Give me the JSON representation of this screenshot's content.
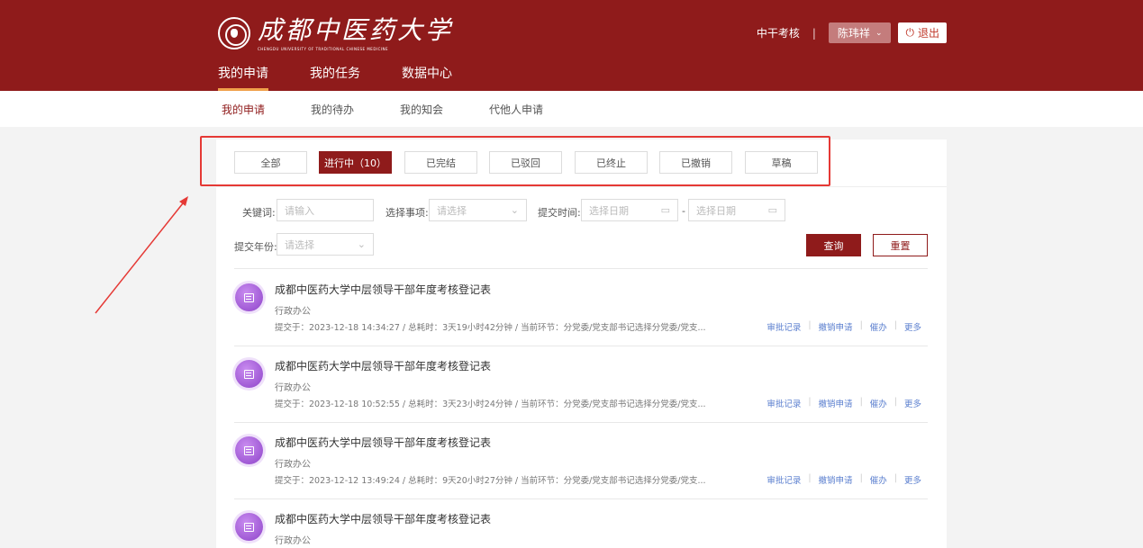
{
  "header": {
    "logo_cn": "成都中医药大学",
    "logo_en": "CHENGDU UNIVERSITY OF TRADITIONAL CHINESE MEDICINE",
    "link": "中干考核",
    "separator": "|",
    "user": "陈玮祥",
    "logout": "退出"
  },
  "main_nav": [
    "我的申请",
    "我的任务",
    "数据中心"
  ],
  "sub_nav": [
    "我的申请",
    "我的待办",
    "我的知会",
    "代他人申请"
  ],
  "tabs": [
    "全部",
    "进行中（10）",
    "已完结",
    "已驳回",
    "已终止",
    "已撤销",
    "草稿"
  ],
  "filters": {
    "keyword_label": "关键词:",
    "keyword_placeholder": "请输入",
    "item_label": "选择事项:",
    "item_placeholder": "请选择",
    "time_label": "提交时间:",
    "date_start": "选择日期",
    "dash": "-",
    "date_end": "选择日期",
    "year_label": "提交年份:",
    "year_placeholder": "请选择",
    "query": "查询",
    "reset": "重置"
  },
  "rows": [
    {
      "title": "成都中医药大学中层领导干部年度考核登记表",
      "dept": "行政办公",
      "meta": "提交于：2023-12-18 14:34:27 / 总耗时：3天19小时42分钟 / 当前环节：分党委/党支部书记选择分党委/党支..."
    },
    {
      "title": "成都中医药大学中层领导干部年度考核登记表",
      "dept": "行政办公",
      "meta": "提交于：2023-12-18 10:52:55 / 总耗时：3天23小时24分钟 / 当前环节：分党委/党支部书记选择分党委/党支..."
    },
    {
      "title": "成都中医药大学中层领导干部年度考核登记表",
      "dept": "行政办公",
      "meta": "提交于：2023-12-12 13:49:24 / 总耗时：9天20小时27分钟 / 当前环节：分党委/党支部书记选择分党委/党支..."
    },
    {
      "title": "成都中医药大学中层领导干部年度考核登记表",
      "dept": "行政办公",
      "meta": ""
    }
  ],
  "row_actions": [
    "审批记录",
    "撤销申请",
    "催办",
    "更多"
  ],
  "colors": {
    "brand": "#8f1b1b",
    "highlight": "#e53935",
    "link": "#5b7fcf"
  }
}
